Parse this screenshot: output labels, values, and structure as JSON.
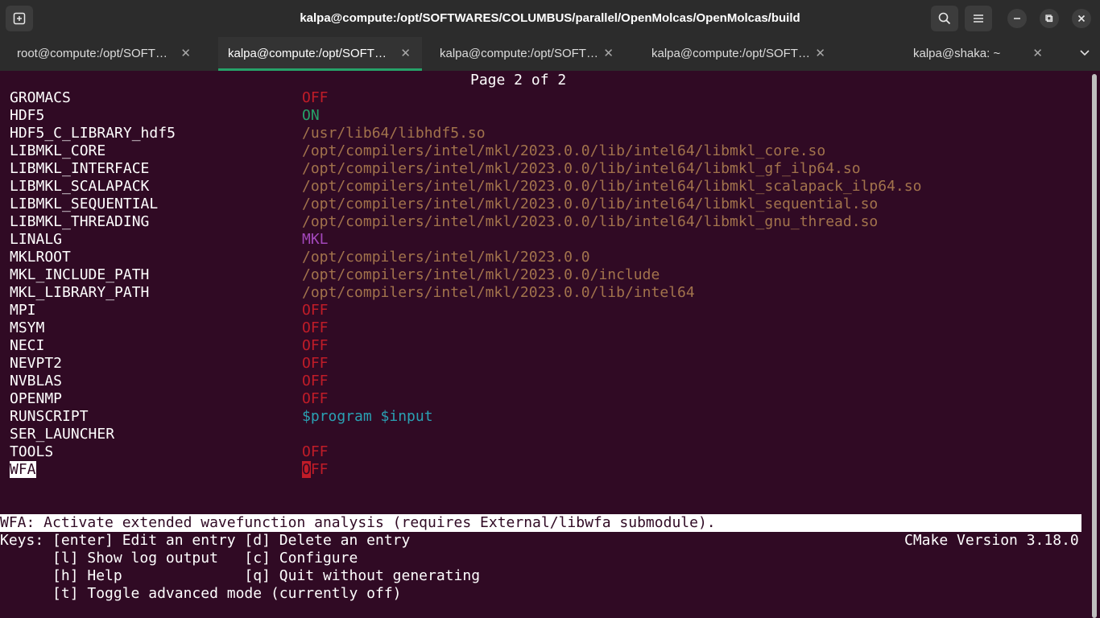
{
  "window": {
    "title": "kalpa@compute:/opt/SOFTWARES/COLUMBUS/parallel/OpenMolcas/OpenMolcas/build"
  },
  "titlebar_icons": {
    "new_tab": "new-tab-icon",
    "search": "search-icon",
    "menu": "hamburger-menu-icon",
    "minimize": "minimize-icon",
    "maximize": "maximize-icon",
    "close": "close-icon"
  },
  "tabs": [
    {
      "label": "root@compute:/opt/SOFT…",
      "active": false
    },
    {
      "label": "kalpa@compute:/opt/SOFT…",
      "active": true
    },
    {
      "label": "kalpa@compute:/opt/SOFT…",
      "active": false
    },
    {
      "label": "kalpa@compute:/opt/SOFT…",
      "active": false
    },
    {
      "label": "kalpa@shaka: ~",
      "active": false
    }
  ],
  "colors": {
    "terminal_bg": "#300a24",
    "accent_tab": "#26a269",
    "off": "#c01c28",
    "on": "#26a269",
    "path": "#a2734c",
    "mkl": "#a347ba",
    "runscript": "#2aa1b3"
  },
  "terminal": {
    "page_header": "Page 2 of 2",
    "entries": [
      {
        "key": "GROMACS",
        "value": "OFF",
        "kind": "off"
      },
      {
        "key": "HDF5",
        "value": "ON",
        "kind": "on"
      },
      {
        "key": "HDF5_C_LIBRARY_hdf5",
        "value": "/usr/lib64/libhdf5.so",
        "kind": "path"
      },
      {
        "key": "LIBMKL_CORE",
        "value": "/opt/compilers/intel/mkl/2023.0.0/lib/intel64/libmkl_core.so",
        "kind": "path"
      },
      {
        "key": "LIBMKL_INTERFACE",
        "value": "/opt/compilers/intel/mkl/2023.0.0/lib/intel64/libmkl_gf_ilp64.so",
        "kind": "path"
      },
      {
        "key": "LIBMKL_SCALAPACK",
        "value": "/opt/compilers/intel/mkl/2023.0.0/lib/intel64/libmkl_scalapack_ilp64.so",
        "kind": "path"
      },
      {
        "key": "LIBMKL_SEQUENTIAL",
        "value": "/opt/compilers/intel/mkl/2023.0.0/lib/intel64/libmkl_sequential.so",
        "kind": "path"
      },
      {
        "key": "LIBMKL_THREADING",
        "value": "/opt/compilers/intel/mkl/2023.0.0/lib/intel64/libmkl_gnu_thread.so",
        "kind": "path"
      },
      {
        "key": "LINALG",
        "value": "MKL",
        "kind": "mkl"
      },
      {
        "key": "MKLROOT",
        "value": "/opt/compilers/intel/mkl/2023.0.0",
        "kind": "path"
      },
      {
        "key": "MKL_INCLUDE_PATH",
        "value": "/opt/compilers/intel/mkl/2023.0.0/include",
        "kind": "path"
      },
      {
        "key": "MKL_LIBRARY_PATH",
        "value": "/opt/compilers/intel/mkl/2023.0.0/lib/intel64",
        "kind": "path"
      },
      {
        "key": "MPI",
        "value": "OFF",
        "kind": "off"
      },
      {
        "key": "MSYM",
        "value": "OFF",
        "kind": "off"
      },
      {
        "key": "NECI",
        "value": "OFF",
        "kind": "off"
      },
      {
        "key": "NEVPT2",
        "value": "OFF",
        "kind": "off"
      },
      {
        "key": "NVBLAS",
        "value": "OFF",
        "kind": "off"
      },
      {
        "key": "OPENMP",
        "value": "OFF",
        "kind": "off"
      },
      {
        "key": "RUNSCRIPT",
        "value": "$program $input",
        "kind": "runscript"
      },
      {
        "key": "SER_LAUNCHER",
        "value": "",
        "kind": "none"
      },
      {
        "key": "TOOLS",
        "value": "OFF",
        "kind": "off"
      }
    ],
    "selected_entry": {
      "key": "WFA",
      "value_cursor": "O",
      "value_rest": "FF"
    },
    "help_text": "WFA: Activate extended wavefunction analysis (requires External/libwfa submodule).",
    "keys_lines": [
      "Keys: [enter] Edit an entry [d] Delete an entry",
      "      [l] Show log output   [c] Configure",
      "      [h] Help              [q] Quit without generating",
      "      [t] Toggle advanced mode (currently off)"
    ],
    "cmake_version": "CMake Version 3.18.0"
  }
}
